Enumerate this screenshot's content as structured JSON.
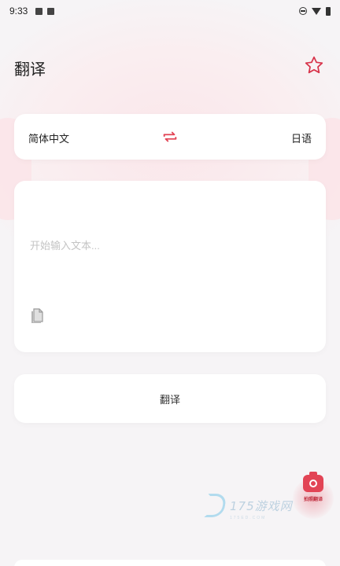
{
  "status_bar": {
    "time": "9:33"
  },
  "header": {
    "title": "翻译",
    "favorite_icon": "star-outline-icon"
  },
  "language_selector": {
    "source_language": "简体中文",
    "target_language": "日语",
    "swap_icon": "swap-arrows-icon"
  },
  "input": {
    "placeholder": "开始输入文本...",
    "value": "",
    "paste_icon": "paste-document-icon"
  },
  "actions": {
    "translate_label": "翻译"
  },
  "floating_button": {
    "icon": "camera-icon",
    "label": "拍照翻译"
  },
  "watermark": {
    "text": "175游戏网",
    "subtext": "175ED.COM"
  },
  "colors": {
    "accent": "#e24455",
    "background": "#f6f4f6",
    "card": "#ffffff"
  }
}
